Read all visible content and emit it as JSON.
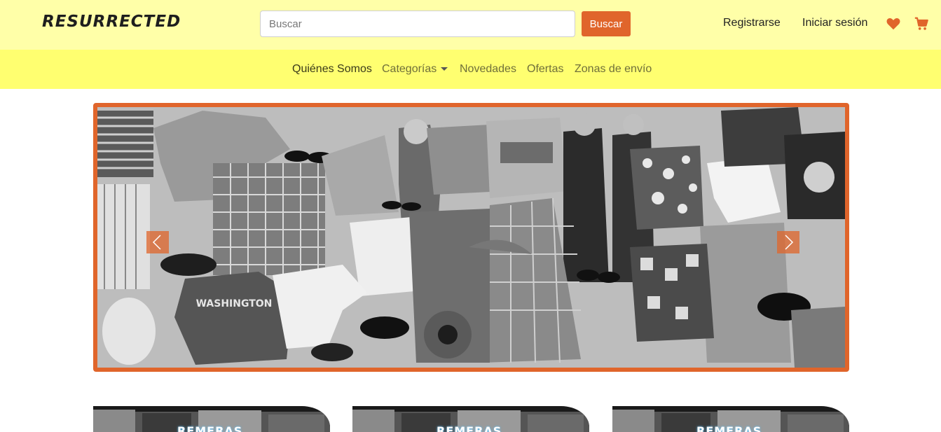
{
  "header": {
    "brand": "RESURRECTED",
    "search": {
      "placeholder": "Buscar",
      "value": "",
      "button_label": "Buscar"
    },
    "register_label": "Registrarse",
    "login_label": "Iniciar sesión",
    "icons": [
      "heart-icon",
      "cart-icon"
    ]
  },
  "nav": {
    "items": [
      {
        "label": "Quiénes Somos",
        "active": true
      },
      {
        "label": "Categorías",
        "dropdown": true
      },
      {
        "label": "Novedades"
      },
      {
        "label": "Ofertas"
      },
      {
        "label": "Zonas de envío"
      }
    ]
  },
  "carousel": {
    "controls": [
      "chevron-left-icon",
      "chevron-right-icon"
    ]
  },
  "cards": [
    {
      "label": "REMERAS"
    },
    {
      "label": "REMERAS"
    },
    {
      "label": "REMERAS"
    }
  ],
  "colors": {
    "accent": "#e0652b",
    "header_bg": "#ffffa8",
    "nav_bg": "#ffff70"
  }
}
